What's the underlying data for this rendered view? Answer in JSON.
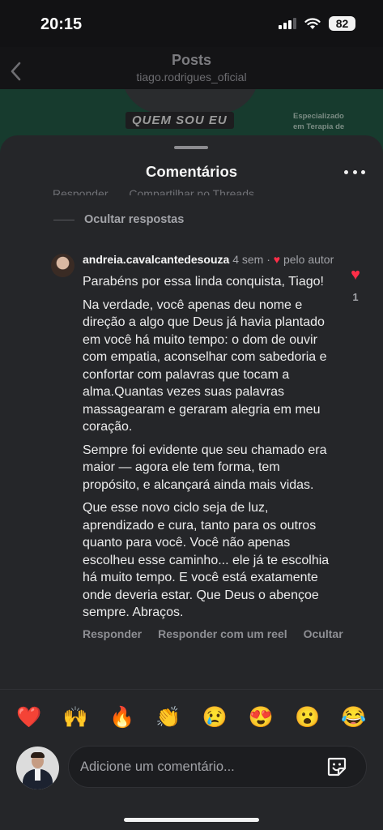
{
  "status_bar": {
    "time": "20:15",
    "battery": "82"
  },
  "post_header": {
    "title": "Posts",
    "subtitle": "tiago.rodrigues_oficial"
  },
  "post_image": {
    "banner": "QUEM SOU EU",
    "side_text_1": "Especializado",
    "side_text_2": "em Terapia de"
  },
  "sheet": {
    "title": "Comentários"
  },
  "previous_actions": {
    "reply": "Responder",
    "share": "Compartilhar no Threads"
  },
  "hide_replies": {
    "label": "Ocultar respostas"
  },
  "comment": {
    "username": "andreia.cavalcantedesouza",
    "time_ago": "4 sem",
    "separator": "·",
    "author_like_suffix": "pelo autor",
    "paragraphs": [
      "Parabéns por essa linda conquista, Tiago!",
      "Na verdade, você apenas deu nome e direção a algo que Deus já havia plantado em você há muito tempo: o dom de ouvir com empatia, aconselhar com sabedoria e confortar com palavras que tocam a alma.Quantas vezes suas palavras massagearam e geraram alegria em meu coração.",
      "Sempre foi evidente que seu chamado era maior — agora ele tem forma, tem propósito, e alcançará ainda mais vidas.",
      "Que esse novo ciclo seja de luz, aprendizado e cura, tanto para os outros quanto para você. Você não apenas escolheu esse caminho... ele já te escolhia há muito tempo. E você está exatamente onde deveria estar. Que Deus o abençoe sempre. Abraços."
    ],
    "actions": {
      "reply": "Responder",
      "reply_reel": "Responder com um reel",
      "hide": "Ocultar"
    },
    "like_count": "1"
  },
  "emoji_bar": [
    "❤️",
    "🙌",
    "🔥",
    "👏",
    "😢",
    "😍",
    "😮",
    "😂"
  ],
  "composer": {
    "placeholder": "Adicione um comentário..."
  },
  "colors": {
    "accent_like": "#ff2e48",
    "sheet_bg": "#252629",
    "post_image_bg": "#173b2e"
  }
}
